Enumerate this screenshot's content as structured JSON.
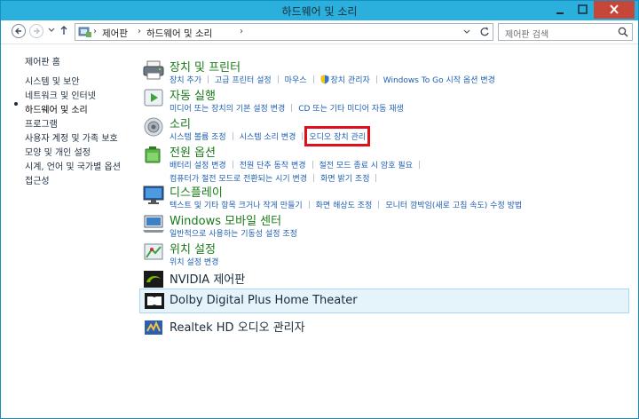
{
  "window": {
    "title": "하드웨어 및 소리"
  },
  "address": {
    "crumbs": [
      "제어판",
      "하드웨어 및 소리"
    ]
  },
  "search": {
    "placeholder": "제어판 검색"
  },
  "sidebar": {
    "items": [
      "제어판 홈",
      "시스템 및 보안",
      "네트워크 및 인터넷",
      "하드웨어 및 소리",
      "프로그램",
      "사용자 계정 및 가족 보호",
      "모양 및 개인 설정",
      "시계, 언어 및 국가별 옵션",
      "접근성"
    ]
  },
  "categories": {
    "devices": {
      "title": "장치 및 프린터",
      "links": [
        "장치 추가",
        "고급 프린터 설정",
        "마우스",
        "장치 관리자",
        "Windows To Go 시작 옵션 변경"
      ]
    },
    "autoplay": {
      "title": "자동 실행",
      "links": [
        "미디어 또는 장치의 기본 설정 변경",
        "CD 또는 기타 미디어 자동 재생"
      ]
    },
    "sound": {
      "title": "소리",
      "links": [
        "시스템 볼륨 조정",
        "시스템 소리 변경",
        "오디오 장치 관리"
      ]
    },
    "power": {
      "title": "전원 옵션",
      "links": [
        "배터리 설정 변경",
        "전원 단추 동작 변경",
        "절전 모드 종료 시 암호 필요"
      ],
      "links2": [
        "컴퓨터가 절전 모드로 전환되는 시기 변경",
        "화면 밝기 조정"
      ]
    },
    "display": {
      "title": "디스플레이",
      "links": [
        "텍스트 및 기타 항목 크거나 작게 만들기",
        "화면 해상도 조정",
        "모니터 깜박임(새로 고침 속도) 수정 방법"
      ]
    },
    "mobility": {
      "title": "Windows 모바일 센터",
      "links": [
        "일반적으로 사용하는 기동성 설정 조정"
      ]
    },
    "location": {
      "title": "위치 설정",
      "links": [
        "위치 설정 변경"
      ]
    },
    "nvidia": {
      "title": "NVIDIA 제어판"
    },
    "dolby": {
      "title": "Dolby Digital Plus Home Theater"
    },
    "realtek": {
      "title": "Realtek HD 오디오 관리자"
    }
  },
  "icons": {
    "devices": "printer-icon",
    "autoplay": "autoplay-icon",
    "sound": "speaker-icon",
    "power": "battery-icon",
    "display": "monitor-icon",
    "mobility": "mobility-center-icon",
    "location": "location-icon",
    "nvidia": "nvidia-icon",
    "dolby": "dolby-icon",
    "realtek": "realtek-icon"
  },
  "colors": {
    "title_bar": "#2bb0de",
    "category_title": "#1a7a1a",
    "link": "#1f5fb0",
    "highlight": "#e0101a"
  }
}
